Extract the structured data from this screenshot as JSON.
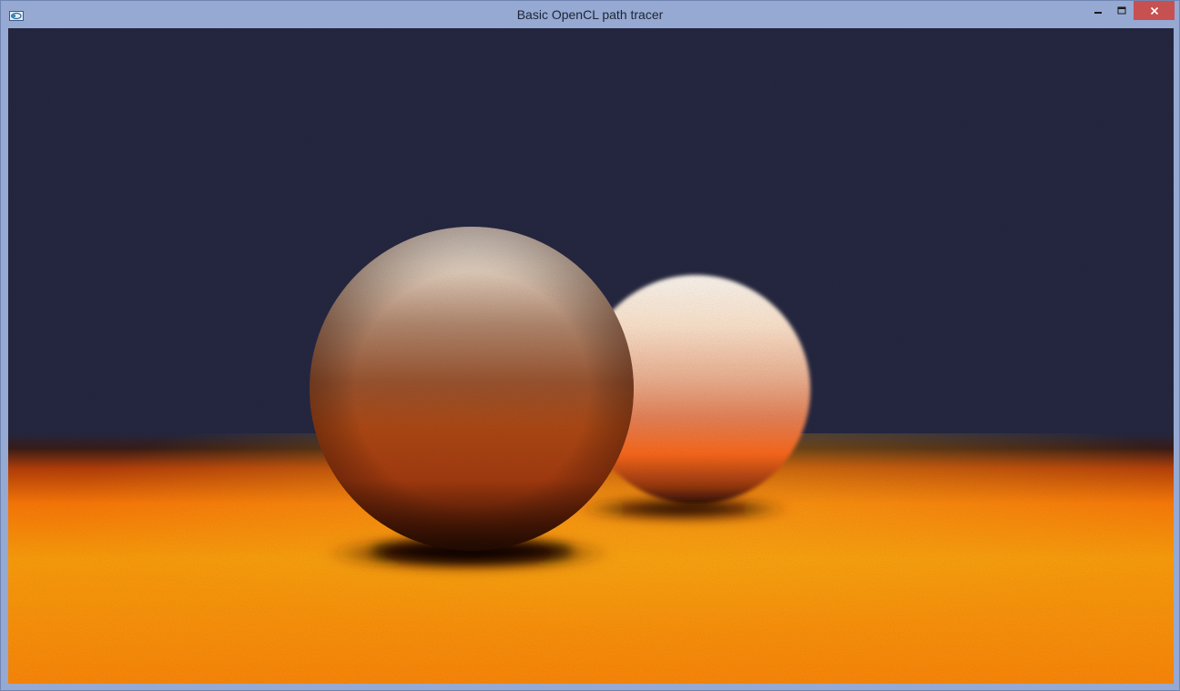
{
  "window": {
    "title": "Basic OpenCL path tracer",
    "icons": {
      "app": "opencl-app-icon",
      "minimize": "minimize-icon",
      "maximize": "maximize-icon",
      "close": "close-icon"
    },
    "colors": {
      "frame": "#95a9d3",
      "close_button": "#c75050"
    }
  },
  "render": {
    "scene": "two-white-spheres-on-orange-plane",
    "colors": {
      "sky": "#262842",
      "floor_near": "#ff9a0a",
      "floor_horizon": "#8a2a05"
    }
  }
}
